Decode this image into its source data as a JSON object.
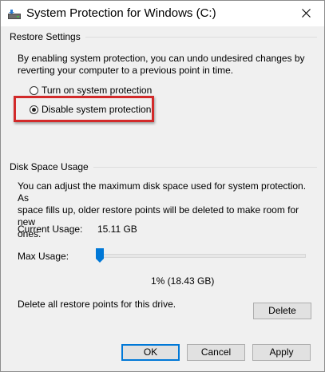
{
  "window": {
    "title": "System Protection for Windows (C:)"
  },
  "restore_settings": {
    "header": "Restore Settings",
    "description_line1": "By enabling system protection, you can undo undesired changes by",
    "description_line2": "reverting your computer to a previous point in time.",
    "options": [
      {
        "label": "Turn on system protection",
        "checked": false
      },
      {
        "label": "Disable system protection",
        "checked": true
      }
    ],
    "highlight_color": "#d22a2a"
  },
  "disk_space": {
    "header": "Disk Space Usage",
    "description_line1": "You can adjust the maximum disk space used for system protection. As",
    "description_line2": "space fills up, older restore points will be deleted to make room for new",
    "description_line3": "ones.",
    "current_usage_label": "Current Usage:",
    "current_usage_value": "15.11 GB",
    "max_usage_label": "Max Usage:",
    "max_usage_fraction": 0.01,
    "max_usage_value": "1% (18.43 GB)",
    "delete_text": "Delete all restore points for this drive.",
    "delete_button": "Delete"
  },
  "buttons": {
    "ok": "OK",
    "cancel": "Cancel",
    "apply": "Apply"
  },
  "colors": {
    "accent": "#0078d7",
    "slider_thumb": "#0078d7"
  },
  "icons": {
    "title_icon": "drive-protection-icon",
    "close_icon": "close-icon"
  }
}
